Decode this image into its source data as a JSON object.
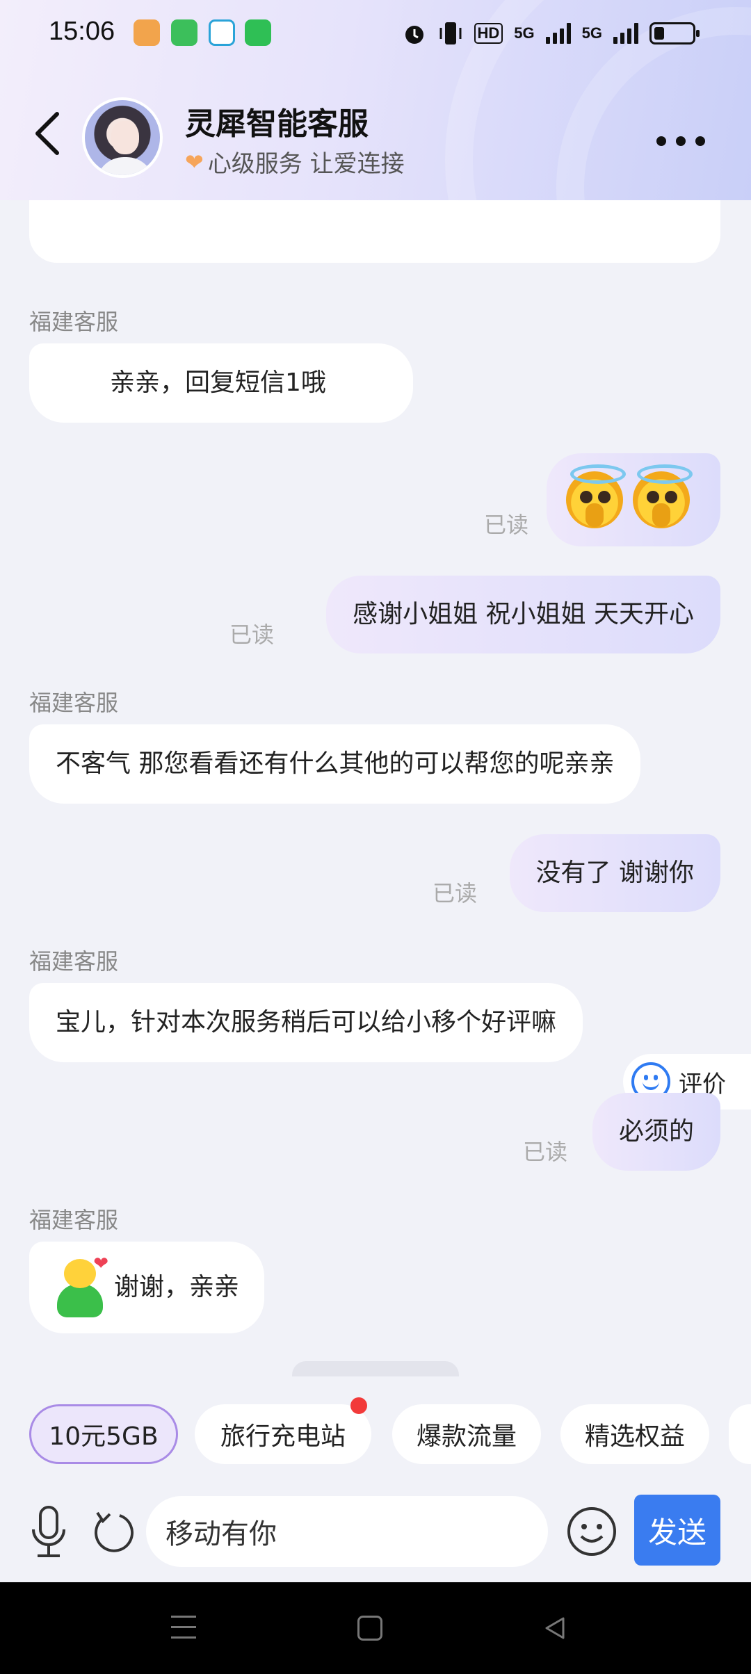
{
  "status_bar": {
    "time": "15:06",
    "hd": "HD",
    "net1": "5G",
    "net2": "5G"
  },
  "header": {
    "title": "灵犀智能客服",
    "subtitle": "心级服务 让爱连接"
  },
  "messages": {
    "m1_sender": "福建客服",
    "m1_text": "亲亲，回复短信1哦",
    "m2_read": "已读",
    "m3_text": "感谢小姐姐 祝小姐姐 天天开心",
    "m3_read": "已读",
    "m4_sender": "福建客服",
    "m4_text": "不客气 那您看看还有什么其他的可以帮您的呢亲亲",
    "m5_text": "没有了 谢谢你",
    "m5_read": "已读",
    "m6_sender": "福建客服",
    "m6_text": "宝儿，针对本次服务稍后可以给小移个好评嘛",
    "m7_text": "必须的",
    "m7_read": "已读",
    "m8_sender": "福建客服",
    "m8_text": "谢谢，亲亲"
  },
  "rating": {
    "label": "评价"
  },
  "chips": [
    "10元5GB",
    "旅行充电站",
    "爆款流量",
    "精选权益"
  ],
  "input": {
    "value": "移动有你",
    "send_label": "发送"
  },
  "colors": {
    "accent": "#3a7cf0",
    "chip_active_border": "#a98be6",
    "badge": "#f23a3a"
  }
}
